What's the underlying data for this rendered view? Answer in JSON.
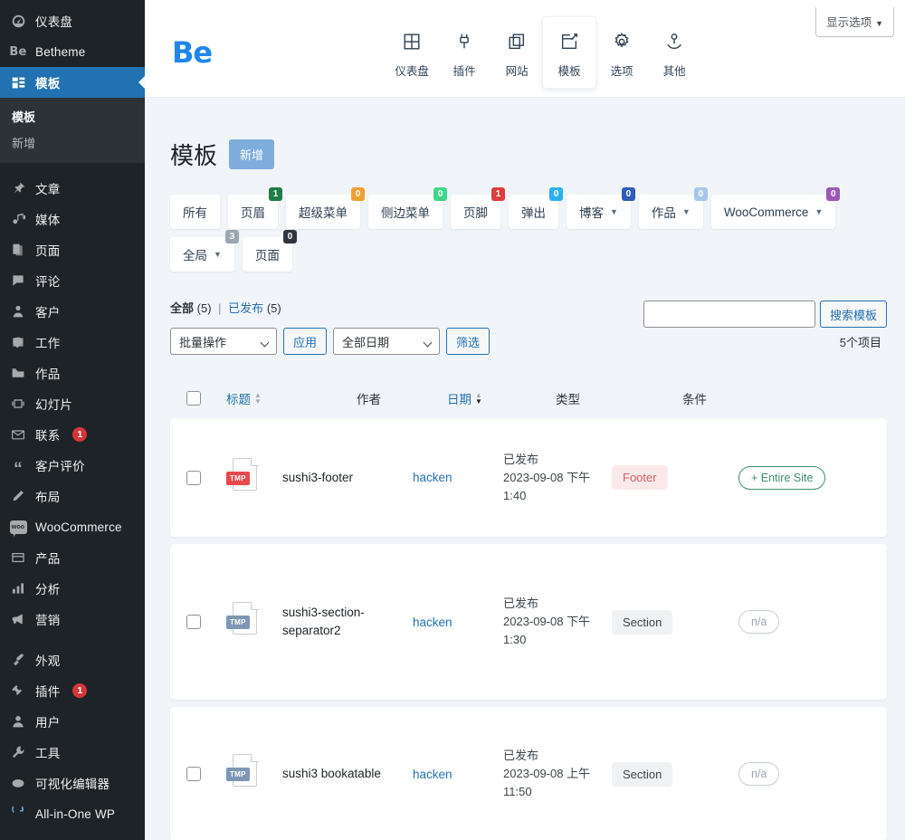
{
  "sidebar": {
    "items": [
      {
        "label": "仪表盘",
        "icon": "dashboard-icon",
        "badge": null
      },
      {
        "label": "Betheme",
        "icon": "betheme-icon",
        "badge": null
      },
      {
        "label": "模板",
        "icon": "templates-icon",
        "badge": null,
        "active": true
      }
    ],
    "submenu": [
      {
        "label": "模板",
        "current": true
      },
      {
        "label": "新增",
        "current": false
      }
    ],
    "items2": [
      {
        "label": "文章",
        "icon": "pin-icon",
        "badge": null
      },
      {
        "label": "媒体",
        "icon": "media-icon",
        "badge": null
      },
      {
        "label": "页面",
        "icon": "page-icon",
        "badge": null
      },
      {
        "label": "评论",
        "icon": "comment-icon",
        "badge": null
      },
      {
        "label": "客户",
        "icon": "client-icon",
        "badge": null
      },
      {
        "label": "工作",
        "icon": "work-icon",
        "badge": null
      },
      {
        "label": "作品",
        "icon": "portfolio-icon",
        "badge": null
      },
      {
        "label": "幻灯片",
        "icon": "slideshow-icon",
        "badge": null
      },
      {
        "label": "联系",
        "icon": "mail-icon",
        "badge": "1"
      },
      {
        "label": "客户评价",
        "icon": "quote-icon",
        "badge": null
      },
      {
        "label": "布局",
        "icon": "pencil-icon",
        "badge": null
      },
      {
        "label": "WooCommerce",
        "icon": "woo-icon",
        "badge": null
      },
      {
        "label": "产品",
        "icon": "product-icon",
        "badge": null
      },
      {
        "label": "分析",
        "icon": "analytics-icon",
        "badge": null
      },
      {
        "label": "营销",
        "icon": "marketing-icon",
        "badge": null
      }
    ],
    "items3": [
      {
        "label": "外观",
        "icon": "appearance-icon",
        "badge": null
      },
      {
        "label": "插件",
        "icon": "plugin-icon",
        "badge": "1"
      },
      {
        "label": "用户",
        "icon": "user-icon",
        "badge": null
      },
      {
        "label": "工具",
        "icon": "tools-icon",
        "badge": null
      },
      {
        "label": "可视化编辑器",
        "icon": "visual-editor-icon",
        "badge": null
      },
      {
        "label": "All-in-One WP",
        "icon": "aio-icon",
        "badge": null
      }
    ]
  },
  "header": {
    "logo": "Be",
    "screen_options": "显示选项",
    "nav": [
      {
        "label": "仪表盘",
        "icon": "grid-icon",
        "active": false
      },
      {
        "label": "插件",
        "icon": "plug-icon",
        "active": false
      },
      {
        "label": "网站",
        "icon": "copy-icon",
        "active": false
      },
      {
        "label": "模板",
        "icon": "edit-doc-icon",
        "active": true
      },
      {
        "label": "选项",
        "icon": "gear-icon",
        "active": false
      },
      {
        "label": "其他",
        "icon": "hand-person-icon",
        "active": false
      }
    ]
  },
  "page": {
    "title": "模板",
    "add_new": "新增",
    "tabs": [
      {
        "label": "所有",
        "count": null,
        "color": null,
        "dropdown": false
      },
      {
        "label": "页眉",
        "count": "1",
        "color": "#1e7e48",
        "dropdown": false
      },
      {
        "label": "超级菜单",
        "count": "0",
        "color": "#f0a030",
        "dropdown": false
      },
      {
        "label": "侧边菜单",
        "count": "0",
        "color": "#3fd68a",
        "dropdown": false
      },
      {
        "label": "页脚",
        "count": "1",
        "color": "#e03c3c",
        "dropdown": false
      },
      {
        "label": "弹出",
        "count": "0",
        "color": "#2ab0f0",
        "dropdown": false
      },
      {
        "label": "博客",
        "count": "0",
        "color": "#2d5eb8",
        "dropdown": true
      },
      {
        "label": "作品",
        "count": "0",
        "color": "#a8c6ea",
        "dropdown": true
      },
      {
        "label": "WooCommerce",
        "count": "0",
        "color": "#9b59b6",
        "dropdown": true
      },
      {
        "label": "全局",
        "count": "3",
        "color": "#9aa6b2",
        "dropdown": true
      },
      {
        "label": "页面",
        "count": "0",
        "color": "#2f3640",
        "dropdown": false
      }
    ],
    "views": {
      "all_label": "全部",
      "all_count": "(5)",
      "separator": "|",
      "published_label": "已发布",
      "published_count": "(5)"
    },
    "search": {
      "value": "",
      "placeholder": "",
      "button": "搜索模板"
    },
    "tablenav": {
      "bulk_actions": "批量操作",
      "apply": "应用",
      "all_dates": "全部日期",
      "filter": "筛选",
      "item_count": "5个项目"
    },
    "columns": {
      "title": "标题",
      "author": "作者",
      "date": "日期",
      "type": "类型",
      "condition": "条件"
    },
    "rows": [
      {
        "title": "sushi3-footer",
        "author": "hacken",
        "status": "已发布",
        "date": "2023-09-08 下午 1:40",
        "tmp_label": "TMP",
        "tmp_color": "#e8474c",
        "type": "Footer",
        "type_bg": "#fbe9ea",
        "type_fg": "#d1616b",
        "condition": "+ Entire Site",
        "cond_fg": "#3f8f6b",
        "cond_border": "#3f8f6b"
      },
      {
        "title": "sushi3-section-separator2",
        "author": "hacken",
        "status": "已发布",
        "date": "2023-09-08 下午 1:30",
        "tmp_label": "TMP",
        "tmp_color": "#7d96b4",
        "type": "Section",
        "type_bg": "#f0f1f3",
        "type_fg": "#3c434a",
        "condition": "n/a",
        "cond_fg": "#9aa6b2",
        "cond_border": "#c6cdd6"
      },
      {
        "title": "sushi3 bookatable",
        "author": "hacken",
        "status": "已发布",
        "date": "2023-09-08 上午 11:50",
        "tmp_label": "TMP",
        "tmp_color": "#7d96b4",
        "type": "Section",
        "type_bg": "#f0f1f3",
        "type_fg": "#3c434a",
        "condition": "n/a",
        "cond_fg": "#9aa6b2",
        "cond_border": "#c6cdd6"
      }
    ]
  }
}
